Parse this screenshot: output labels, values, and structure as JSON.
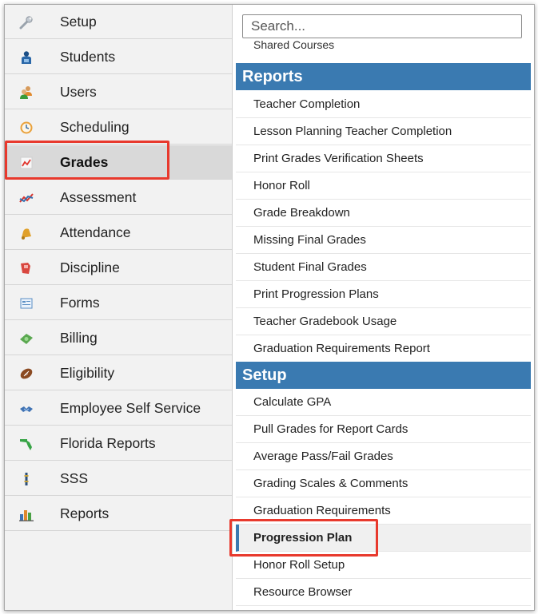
{
  "nav": {
    "items": [
      {
        "label": "Setup",
        "icon": "wrench-icon"
      },
      {
        "label": "Students",
        "icon": "student-icon"
      },
      {
        "label": "Users",
        "icon": "users-icon"
      },
      {
        "label": "Scheduling",
        "icon": "clock-icon"
      },
      {
        "label": "Grades",
        "icon": "gradebook-icon",
        "active": true
      },
      {
        "label": "Assessment",
        "icon": "assessment-chart-icon"
      },
      {
        "label": "Attendance",
        "icon": "bell-icon"
      },
      {
        "label": "Discipline",
        "icon": "discipline-icon"
      },
      {
        "label": "Forms",
        "icon": "form-icon"
      },
      {
        "label": "Billing",
        "icon": "money-icon"
      },
      {
        "label": "Eligibility",
        "icon": "football-icon"
      },
      {
        "label": "Employee Self Service",
        "icon": "handshake-icon"
      },
      {
        "label": "Florida Reports",
        "icon": "florida-map-icon"
      },
      {
        "label": "SSS",
        "icon": "sss-icon"
      },
      {
        "label": "Reports",
        "icon": "bar-chart-icon"
      }
    ]
  },
  "menu": {
    "search_placeholder": "Search...",
    "cut_item": "Shared Courses",
    "reports_header": "Reports",
    "reports_items": [
      "Teacher Completion",
      "Lesson Planning Teacher Completion",
      "Print Grades Verification Sheets",
      "Honor Roll",
      "Grade Breakdown",
      "Missing Final Grades",
      "Student Final Grades",
      "Print Progression Plans",
      "Teacher Gradebook Usage",
      "Graduation Requirements Report"
    ],
    "setup_header": "Setup",
    "setup_items": [
      "Calculate GPA",
      "Pull Grades for Report Cards",
      "Average Pass/Fail Grades",
      "Grading Scales & Comments",
      "Graduation Requirements",
      "Progression Plan",
      "Honor Roll Setup",
      "Resource Browser"
    ],
    "active_item": "Progression Plan"
  },
  "colors": {
    "section_header": "#3a7ab1",
    "highlight": "#e8392d"
  }
}
